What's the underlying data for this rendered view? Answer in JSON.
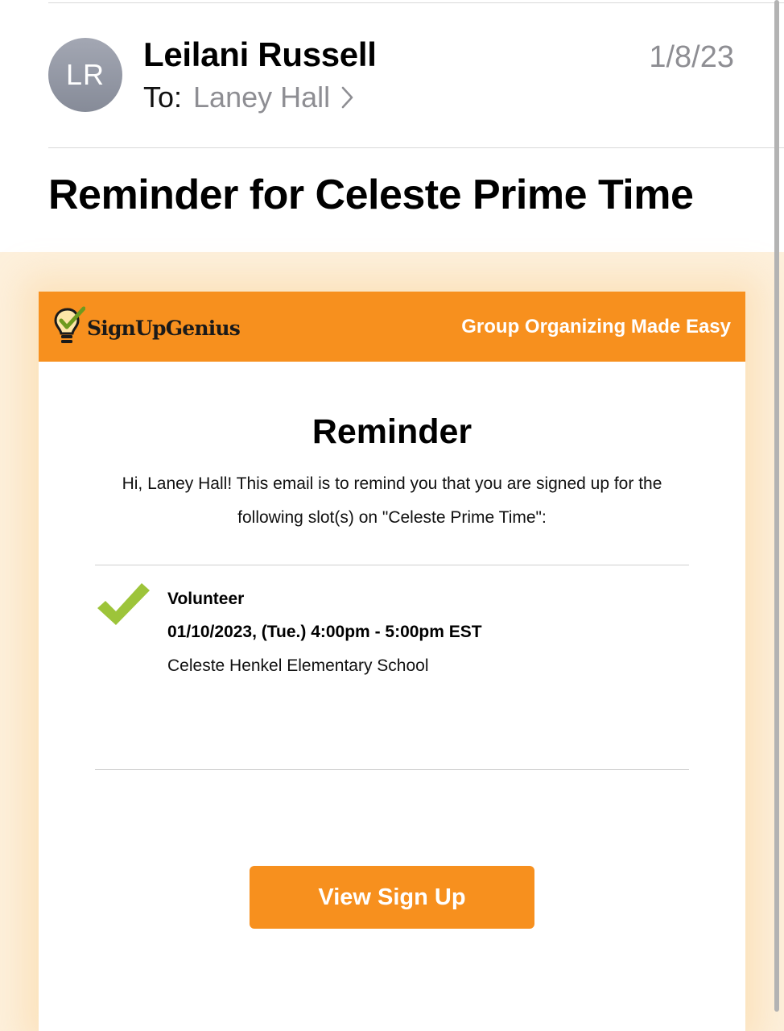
{
  "header": {
    "avatar_initials": "LR",
    "sender": "Leilani Russell",
    "to_label": "To:",
    "recipient": "Laney Hall",
    "date": "1/8/23",
    "subject": "Reminder for Celeste Prime Time"
  },
  "email": {
    "brand": "SignUpGenius",
    "tagline": "Group Organizing Made Easy",
    "heading": "Reminder",
    "intro": "Hi, Laney Hall! This email is to remind you that you are signed up for the following slot(s) on \"Celeste Prime Time\":",
    "slot": {
      "title": "Volunteer",
      "datetime": "01/10/2023, (Tue.) 4:00pm - 5:00pm EST",
      "location": "Celeste Henkel Elementary School"
    },
    "button_label": "View Sign Up"
  },
  "colors": {
    "brand_orange": "#f7901e",
    "check_green": "#9dc43a",
    "muted_gray": "#8e8e93"
  },
  "icons": {
    "logo": "lightbulb-check-icon",
    "recipient_chevron": "chevron-right-icon",
    "slot_check": "checkmark-icon"
  }
}
